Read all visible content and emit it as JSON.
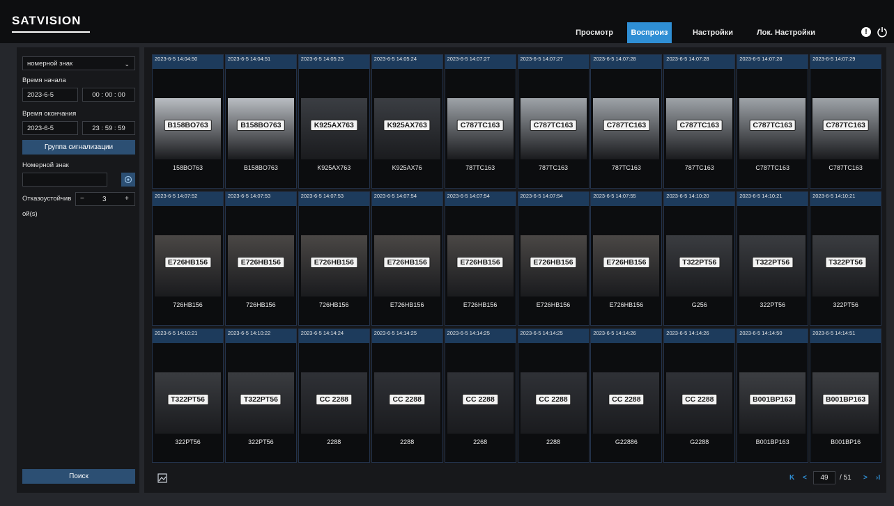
{
  "brand": "SATVISION",
  "nav": {
    "tabs": [
      {
        "label": "Просмотр",
        "active": false
      },
      {
        "label": "Воспроиз",
        "active": true
      },
      {
        "label": "Настройки",
        "active": false
      },
      {
        "label": "Лок. Настройки",
        "active": false
      }
    ],
    "alert_icon": "exclamation-icon",
    "power_icon": "power-icon"
  },
  "sidebar": {
    "type_select": "номерной знак",
    "start_label": "Время начала",
    "start_date": "2023-6-5",
    "start_time": "00 : 00 : 00",
    "end_label": "Время окончания",
    "end_date": "2023-6-5",
    "end_time": "23 : 59 : 59",
    "alarm_group_button": "Группа сигнализации",
    "plate_label": "Номерной знак",
    "plate_value": "",
    "fault_label_1": "Отказоустойчив",
    "fault_label_2": "ой(s)",
    "fault_minus": "−",
    "fault_value": "3",
    "fault_plus": "+",
    "search_button": "Поиск"
  },
  "cards": [
    {
      "ts": "2023-6-5 14:04:50",
      "label": "158BO763",
      "plate": "B158BO763",
      "bg": "#b9bdc2"
    },
    {
      "ts": "2023-6-5 14:04:51",
      "label": "B158BO763",
      "plate": "B158BO763",
      "bg": "#b9bdc2"
    },
    {
      "ts": "2023-6-5 14:05:23",
      "label": "K925AX763",
      "plate": "K925AX763",
      "bg": "#3b3e43"
    },
    {
      "ts": "2023-6-5 14:05:24",
      "label": "K925AX76",
      "plate": "K925AX763",
      "bg": "#3b3e43"
    },
    {
      "ts": "2023-6-5 14:07:27",
      "label": "787TC163",
      "plate": "C787TC163",
      "bg": "#9ea3a8"
    },
    {
      "ts": "2023-6-5 14:07:27",
      "label": "787TC163",
      "plate": "C787TC163",
      "bg": "#9ea3a8"
    },
    {
      "ts": "2023-6-5 14:07:28",
      "label": "787TC163",
      "plate": "C787TC163",
      "bg": "#9ea3a8"
    },
    {
      "ts": "2023-6-5 14:07:28",
      "label": "787TC163",
      "plate": "C787TC163",
      "bg": "#9ea3a8"
    },
    {
      "ts": "2023-6-5 14:07:28",
      "label": "C787TC163",
      "plate": "C787TC163",
      "bg": "#9ea3a8"
    },
    {
      "ts": "2023-6-5 14:07:29",
      "label": "C787TC163",
      "plate": "C787TC163",
      "bg": "#9ea3a8"
    },
    {
      "ts": "2023-6-5 14:07:52",
      "label": "726HB156",
      "plate": "E726HB156",
      "bg": "#4a4745"
    },
    {
      "ts": "2023-6-5 14:07:53",
      "label": "726HB156",
      "plate": "E726HB156",
      "bg": "#4a4745"
    },
    {
      "ts": "2023-6-5 14:07:53",
      "label": "726HB156",
      "plate": "E726HB156",
      "bg": "#4a4745"
    },
    {
      "ts": "2023-6-5 14:07:54",
      "label": "E726HB156",
      "plate": "E726HB156",
      "bg": "#4a4745"
    },
    {
      "ts": "2023-6-5 14:07:54",
      "label": "E726HB156",
      "plate": "E726HB156",
      "bg": "#4a4745"
    },
    {
      "ts": "2023-6-5 14:07:54",
      "label": "E726HB156",
      "plate": "E726HB156",
      "bg": "#4a4745"
    },
    {
      "ts": "2023-6-5 14:07:55",
      "label": "E726HB156",
      "plate": "E726HB156",
      "bg": "#4a4745"
    },
    {
      "ts": "2023-6-5 14:10:20",
      "label": "G256",
      "plate": "T322PT56",
      "bg": "#3a3c40"
    },
    {
      "ts": "2023-6-5 14:10:21",
      "label": "322PT56",
      "plate": "T322PT56",
      "bg": "#3a3c40"
    },
    {
      "ts": "2023-6-5 14:10:21",
      "label": "322PT56",
      "plate": "T322PT56",
      "bg": "#3a3c40"
    },
    {
      "ts": "2023-6-5 14:10:21",
      "label": "322PT56",
      "plate": "T322PT56",
      "bg": "#3a3c40"
    },
    {
      "ts": "2023-6-5 14:10:22",
      "label": "322PT56",
      "plate": "T322PT56",
      "bg": "#3a3c40"
    },
    {
      "ts": "2023-6-5 14:14:24",
      "label": "2288",
      "plate": "CC 2288",
      "bg": "#2f3136"
    },
    {
      "ts": "2023-6-5 14:14:25",
      "label": "2288",
      "plate": "CC 2288",
      "bg": "#2f3136"
    },
    {
      "ts": "2023-6-5 14:14:25",
      "label": "2268",
      "plate": "CC 2288",
      "bg": "#2f3136"
    },
    {
      "ts": "2023-6-5 14:14:25",
      "label": "2288",
      "plate": "CC 2288",
      "bg": "#2f3136"
    },
    {
      "ts": "2023-6-5 14:14:26",
      "label": "G22886",
      "plate": "CC 2288",
      "bg": "#2f3136"
    },
    {
      "ts": "2023-6-5 14:14:26",
      "label": "G2288",
      "plate": "CC 2288",
      "bg": "#2f3136"
    },
    {
      "ts": "2023-6-5 14:14:50",
      "label": "B001BP163",
      "plate": "B001BP163",
      "bg": "#3c3e42"
    },
    {
      "ts": "2023-6-5 14:14:51",
      "label": "B001BP16",
      "plate": "B001BP163",
      "bg": "#3c3e42"
    }
  ],
  "pager": {
    "first": "K",
    "prev": "<",
    "current": "49",
    "total": "/ 51",
    "next": ">",
    "last": "›I"
  },
  "colors": {
    "accent": "#2f8fd5",
    "header": "#1d3b5c",
    "button": "#2c4f73"
  }
}
